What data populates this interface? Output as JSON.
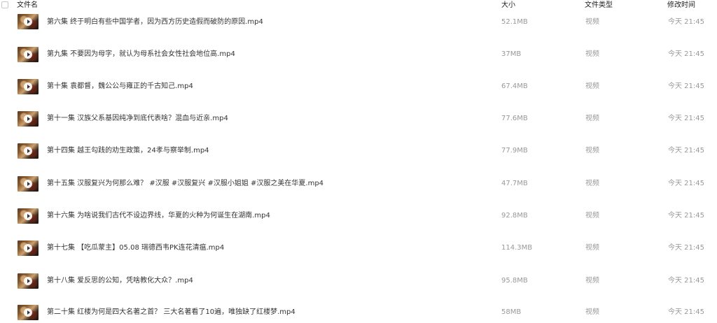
{
  "header": {
    "name": "文件名",
    "size": "大小",
    "type": "文件类型",
    "modified": "修改时间"
  },
  "files": [
    {
      "name": "第六集  终于明白有些中国学者，因为西方历史造假而破防的原因.mp4",
      "size": "52.1MB",
      "type": "视频",
      "modified": "今天 21:45"
    },
    {
      "name": "第九集  不要因为母字，就认为母系社会女性社会地位高.mp4",
      "size": "37MB",
      "type": "视频",
      "modified": "今天 21:45"
    },
    {
      "name": "第十集  袁都督，魏公公与雍正的千古知己.mp4",
      "size": "67.4MB",
      "type": "视频",
      "modified": "今天 21:45"
    },
    {
      "name": "第十一集  汉族父系基因纯净到底代表啥？混血与近亲.mp4",
      "size": "77.6MB",
      "type": "视频",
      "modified": "今天 21:45"
    },
    {
      "name": "第十四集  越王勾践的劝生政策，24孝与察举制.mp4",
      "size": "77.9MB",
      "type": "视频",
      "modified": "今天 21:45"
    },
    {
      "name": "第十五集  汉服复兴为何那么难？  #汉服 #汉服复兴 #汉服小姐姐 #汉服之美在华夏.mp4",
      "size": "47.7MB",
      "type": "视频",
      "modified": "今天 21:45"
    },
    {
      "name": "第十六集  为啥说我们古代不设边界线，华夏的火种为何诞生在湖南.mp4",
      "size": "92.8MB",
      "type": "视频",
      "modified": "今天 21:45"
    },
    {
      "name": "第十七集  【吃瓜蒙主】05.08 瑞德西韦PK连花清瘟.mp4",
      "size": "114.3MB",
      "type": "视频",
      "modified": "今天 21:45"
    },
    {
      "name": "第十八集   爱反思的公知，凭啥教化大众？.mp4",
      "size": "95.8MB",
      "type": "视频",
      "modified": "今天 21:45"
    },
    {
      "name": "第二十集  红楼为何是四大名著之首？  三大名著看了10遍，唯独缺了红楼梦.mp4",
      "size": "58MB",
      "type": "视频",
      "modified": "今天 21:45"
    }
  ]
}
